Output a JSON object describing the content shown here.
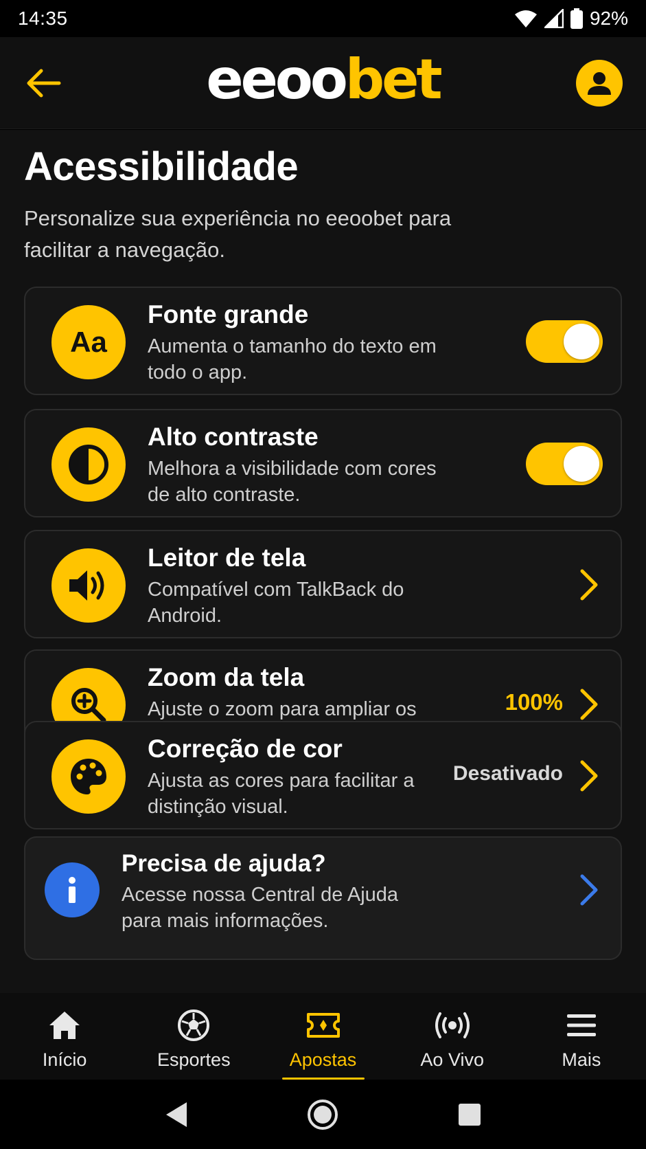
{
  "status_bar": {
    "time": "14:35",
    "battery": "92%"
  },
  "app_bar": {
    "logo_white": "eeoo",
    "logo_yellow": "bet"
  },
  "page": {
    "title": "Acessibilidade",
    "subtitle": "Personalize sua experiência no eeoobet para facilitar a navegação."
  },
  "settings": [
    {
      "id": "fonte-grande",
      "icon": "text-size-icon",
      "icon_text": "Aa",
      "title": "Fonte grande",
      "description": "Aumenta o tamanho do texto em todo o app.",
      "control": "toggle",
      "enabled": true
    },
    {
      "id": "alto-contraste",
      "icon": "contrast-icon",
      "title": "Alto contraste",
      "description": "Melhora a visibilidade com cores de alto contraste.",
      "control": "toggle",
      "enabled": true
    },
    {
      "id": "leitor-de-tela",
      "icon": "speaker-icon",
      "title": "Leitor de tela",
      "description": "Compatível com TalkBack do Android.",
      "control": "chevron"
    },
    {
      "id": "zoom-da-tela",
      "icon": "zoom-in-icon",
      "title": "Zoom da tela",
      "description": "Ajuste o zoom para ampliar os elementos da tela.",
      "control": "chevron",
      "value": "100%"
    },
    {
      "id": "correcao-de-cor",
      "icon": "palette-icon",
      "title": "Correção de cor",
      "description": "Ajusta as cores para facilitar a distinção visual.",
      "control": "chevron",
      "value": "Desativado"
    }
  ],
  "help": {
    "title": "Precisa de ajuda?",
    "description": "Acesse nossa Central de Ajuda para mais informações.",
    "icon": "info-icon"
  },
  "bottom_nav": [
    {
      "label": "Início",
      "icon": "home-icon",
      "active": false
    },
    {
      "label": "Esportes",
      "icon": "soccer-ball-icon",
      "active": false
    },
    {
      "label": "Apostas",
      "icon": "ticket-icon",
      "active": true
    },
    {
      "label": "Ao Vivo",
      "icon": "live-broadcast-icon",
      "active": false
    },
    {
      "label": "Mais",
      "icon": "menu-icon",
      "active": false
    }
  ],
  "colors": {
    "accent": "#FFC400",
    "background": "#121212",
    "card": "#161616",
    "info_blue": "#2F6FE4"
  }
}
